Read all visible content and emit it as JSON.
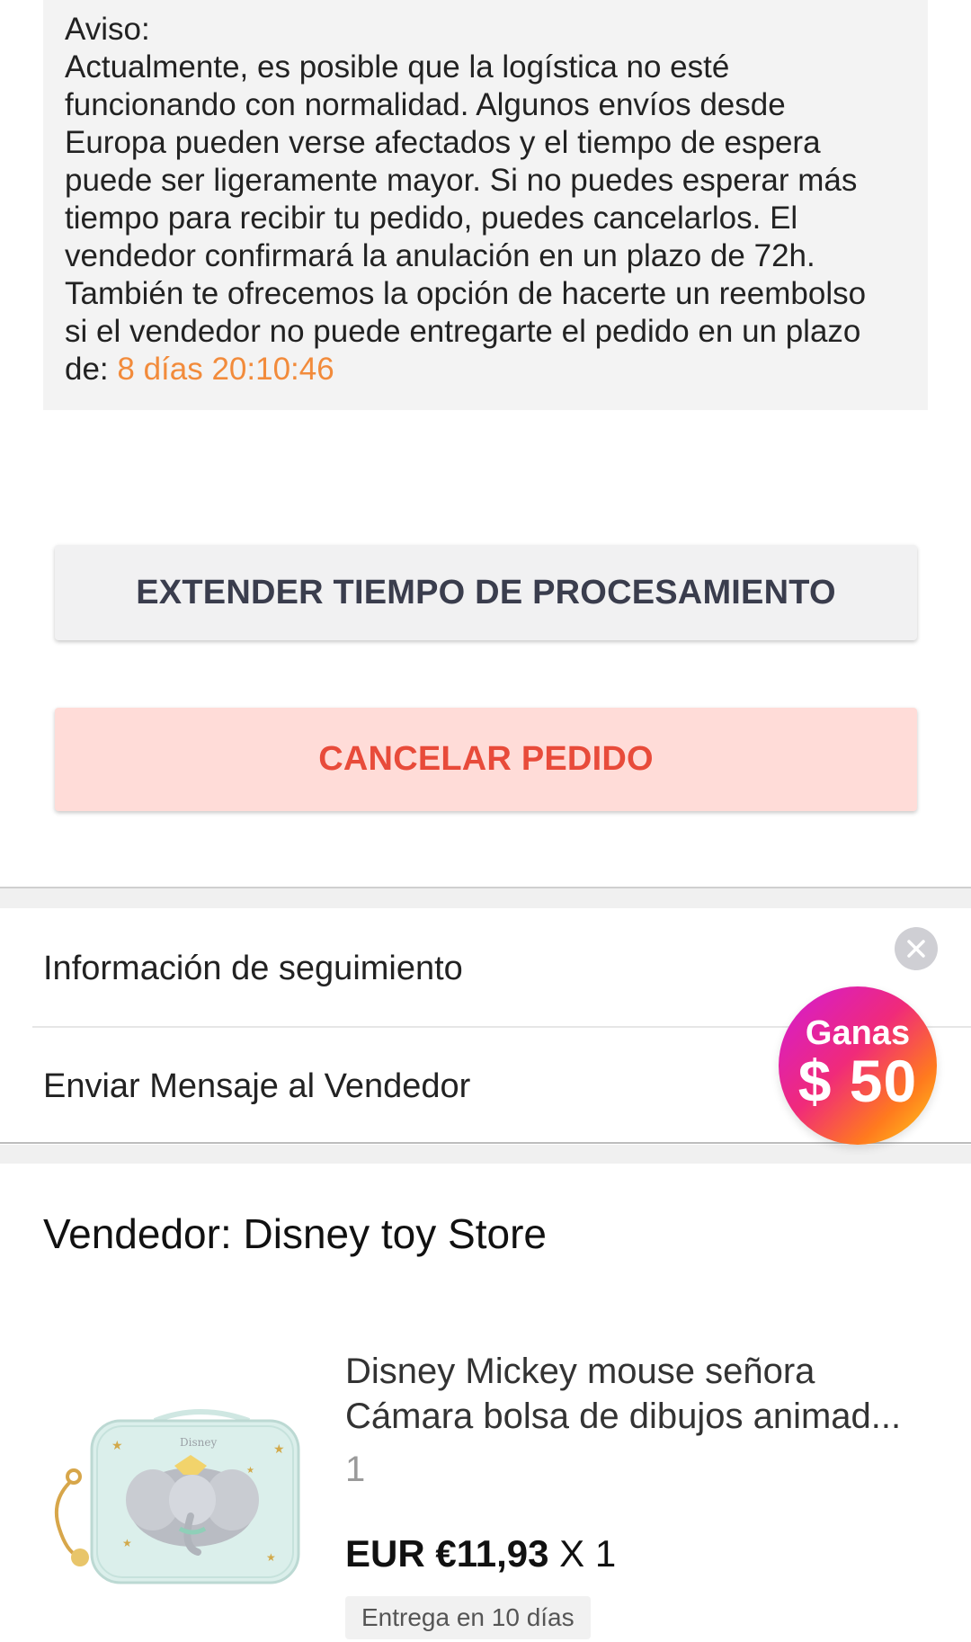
{
  "notice": {
    "heading": "Aviso:",
    "lines": [
      "Actualmente, es posible que la logística no esté",
      "funcionando con normalidad. Algunos envíos desde",
      "Europa pueden verse afectados y el tiempo de espera",
      "puede ser ligeramente mayor. Si no puedes esperar más",
      "tiempo para recibir tu pedido, puedes cancelarlos. El",
      "vendedor confirmará la anulación en un plazo de 72h.",
      "También te ofrecemos la opción de hacerte un reembolso",
      "si el vendedor no puede entregarte el pedido en un plazo"
    ],
    "last_prefix": "de: ",
    "countdown": "8 días 20:10:46",
    "countdown_color": "#f28b3b"
  },
  "actions": {
    "extend_label": "EXTENDER TIEMPO DE PROCESAMIENTO",
    "cancel_label": "CANCELAR PEDIDO",
    "cancel_color": "#e84b3a"
  },
  "menu": {
    "tracking_label": "Información de seguimiento",
    "message_label": "Enviar Mensaje al Vendedor"
  },
  "promo": {
    "line1": "Ganas",
    "line2": "$ 50",
    "close_icon": "close-icon"
  },
  "seller": {
    "label": "Vendedor: Disney toy Store"
  },
  "product": {
    "title_line1": "Disney Mickey mouse señora",
    "title_line2": "Cámara bolsa de dibujos animad...",
    "variant": "1",
    "price": "EUR €11,93",
    "quantity": "X 1",
    "delivery": "Entrega en 10 días",
    "image_icon": "dumbo-bag-image"
  }
}
